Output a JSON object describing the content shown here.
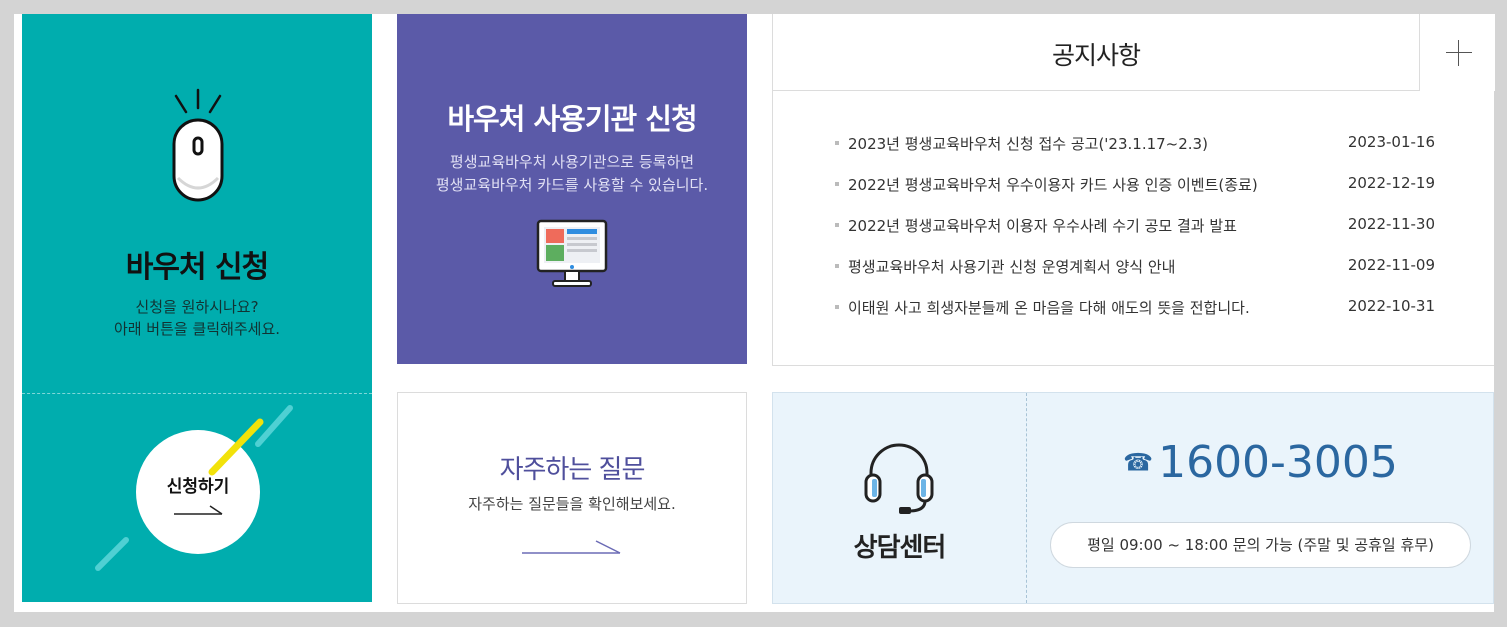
{
  "voucher_apply": {
    "title": "바우처 신청",
    "desc_line1": "신청을 원하시나요?",
    "desc_line2": "아래 버튼을 클릭해주세요.",
    "button_label": "신청하기"
  },
  "institution_apply": {
    "title": "바우처 사용기관 신청",
    "desc_line1": "평생교육바우처 사용기관으로 등록하면",
    "desc_line2": "평생교육바우처 카드를 사용할 수 있습니다."
  },
  "notice": {
    "title": "공지사항",
    "items": [
      {
        "text": "2023년 평생교육바우처 신청 접수 공고('23.1.17~2.3)",
        "date": "2023-01-16"
      },
      {
        "text": "2022년 평생교육바우처 우수이용자 카드 사용 인증 이벤트(종료)",
        "date": "2022-12-19"
      },
      {
        "text": "2022년 평생교육바우처 이용자 우수사례 수기 공모 결과 발표",
        "date": "2022-11-30"
      },
      {
        "text": "평생교육바우처 사용기관 신청 운영계획서 양식 안내",
        "date": "2022-11-09"
      },
      {
        "text": "이태원 사고 희생자분들께 온 마음을 다해 애도의 뜻을 전합니다.",
        "date": "2022-10-31"
      }
    ]
  },
  "faq": {
    "title": "자주하는 질문",
    "desc": "자주하는 질문들을 확인해보세요."
  },
  "counsel": {
    "label": "상담센터",
    "phone_icon": "☎",
    "phone": "1600-3005",
    "hours": "평일 09:00 ~ 18:00 문의 가능 (주말 및 공휴일 휴무)"
  },
  "colors": {
    "teal": "#00adae",
    "purple": "#5b5aa8",
    "phone_blue": "#2b67a0",
    "counsel_bg": "#eaf4fb",
    "accent_yellow": "#f2e20a"
  }
}
